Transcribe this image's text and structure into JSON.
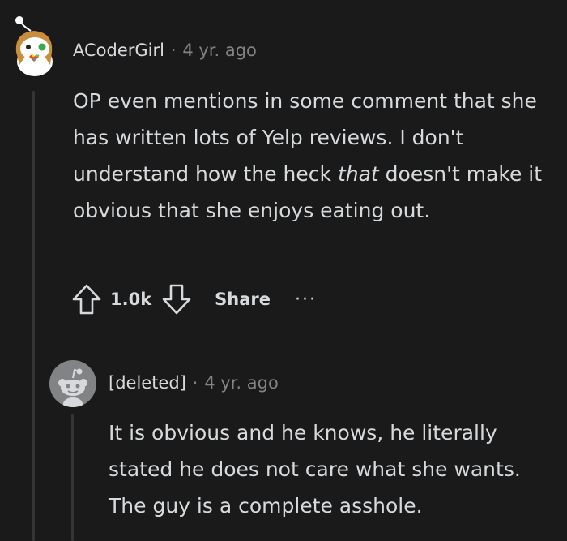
{
  "comment1": {
    "author": "ACoderGirl",
    "separator": "·",
    "time": "4 yr. ago",
    "body": {
      "part1": "OP even mentions in some comment that she has written lots of Yelp reviews. I don't understand how the heck ",
      "emphasis": "that",
      "part2": " doesn't make it obvious that she enjoys eating out."
    },
    "votes": "1.0k",
    "share_label": "Share",
    "more_label": "···"
  },
  "comment2": {
    "author": "[deleted]",
    "separator": "·",
    "time": "4 yr. ago",
    "body": "It is obvious and he knows, he literally stated he does not care what she wants. The guy is a complete asshole."
  },
  "icons": {
    "upvote": "arrow-up-outline",
    "downvote": "arrow-down-outline",
    "more": "ellipsis"
  }
}
